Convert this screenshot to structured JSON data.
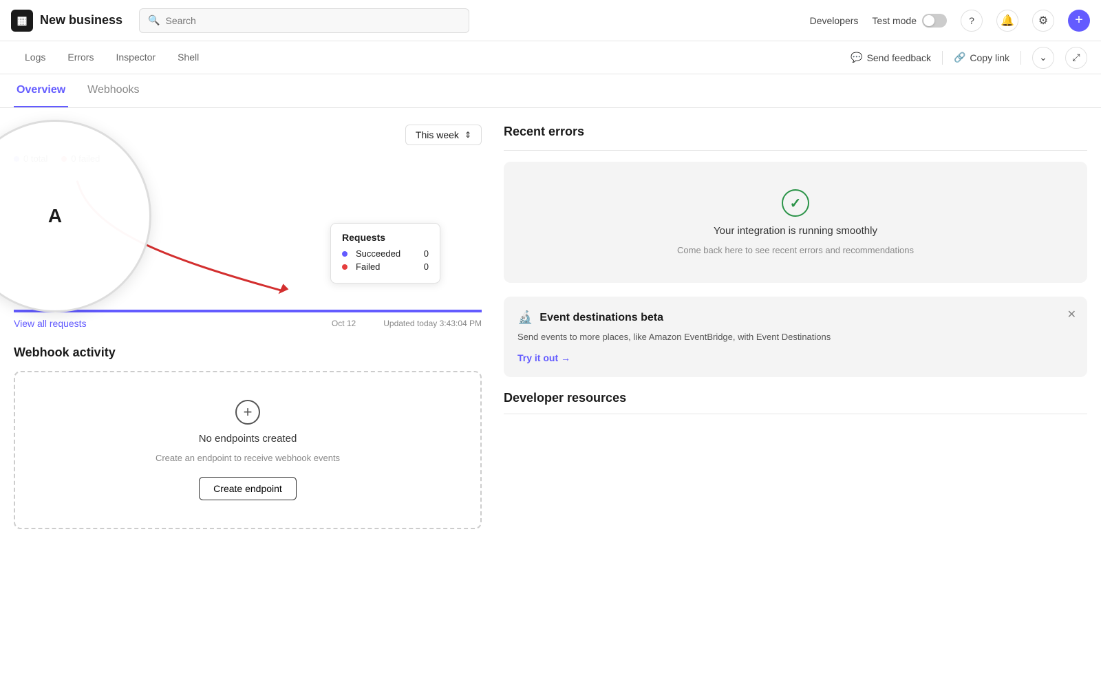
{
  "brand": {
    "icon": "▦",
    "name": "New business"
  },
  "search": {
    "placeholder": "Search"
  },
  "nav": {
    "developers_label": "Developers",
    "test_mode_label": "Test mode",
    "help_icon": "?",
    "bell_icon": "🔔",
    "gear_icon": "⚙",
    "add_icon": "+"
  },
  "sub_nav": {
    "tabs": [
      {
        "label": "Logs",
        "active": false
      },
      {
        "label": "Errors",
        "active": false
      },
      {
        "label": "Inspector",
        "active": false
      },
      {
        "label": "Shell",
        "active": false
      }
    ],
    "actions": [
      {
        "label": "Send feedback",
        "icon": "💬"
      },
      {
        "label": "Copy link",
        "icon": "🔗"
      }
    ]
  },
  "main_tabs": [
    {
      "label": "Overview",
      "active": true
    },
    {
      "label": "Webhooks",
      "active": false
    }
  ],
  "chart": {
    "week_selector": "This week",
    "legend": [
      {
        "label": "0 total",
        "color": "#635bff"
      },
      {
        "label": "0 failed",
        "color": "#e53e3e"
      }
    ],
    "date_label": "Oct 12",
    "updated_text": "Updated today 3:43:04 PM",
    "view_all_label": "View all requests",
    "tooltip": {
      "title": "Requests",
      "rows": [
        {
          "label": "Succeeded",
          "value": "0",
          "color": "#635bff"
        },
        {
          "label": "Failed",
          "value": "0",
          "color": "#e53e3e"
        }
      ]
    }
  },
  "webhook": {
    "section_title": "Webhook activity",
    "empty_title": "No endpoints created",
    "empty_subtitle": "Create an endpoint to receive webhook events",
    "create_btn": "Create endpoint"
  },
  "recent_errors": {
    "title": "Recent errors",
    "success_icon": "✓",
    "success_main": "Your integration is running smoothly",
    "success_sub": "Come back here to see recent errors and recommendations"
  },
  "event_card": {
    "icon": "🔬",
    "title": "Event destinations beta",
    "body": "Send events to more places, like Amazon EventBridge, with Event Destinations",
    "try_label": "Try it out",
    "try_arrow": "→"
  },
  "developer_resources": {
    "title": "Developer resources"
  }
}
